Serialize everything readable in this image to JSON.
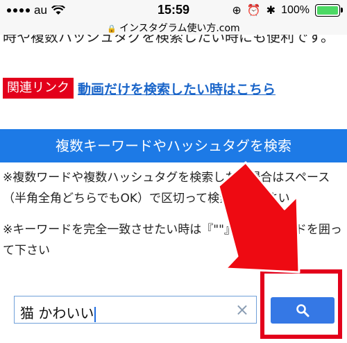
{
  "status_bar": {
    "carrier": "au",
    "time": "15:59",
    "battery": "100%",
    "battery_level": 1.0
  },
  "browser": {
    "url": "インスタグラム使い方.com"
  },
  "article": {
    "intro_text": "時や複数ハッシュタグを検索したい時にも便利です。",
    "related_badge": "関連リンク",
    "related_link": "動画だけを検索したい時はこちら"
  },
  "search_section": {
    "header": "複数キーワードやハッシュタグを検索",
    "note_1": "※複数ワードや複数ハッシュタグを検索したい場合はスペース（半角全角どちらでもOK）で区切って検索して下さい",
    "note_2": "※キーワードを完全一致させたい時は『\"\"』でキーワードを囲って下さい",
    "input_value": "猫 かわいい"
  },
  "icons": [
    "wifi-icon",
    "lock-icon",
    "alarm-icon",
    "bluetooth-icon",
    "battery-icon",
    "clear-icon",
    "search-icon",
    "arrow-icon"
  ],
  "colors": {
    "header_blue": "#1d7ae6",
    "badge_red": "#e3001b",
    "link_blue": "#1a65c9",
    "search_button": "#3578e5",
    "annotation_red": "#ee0a12"
  }
}
